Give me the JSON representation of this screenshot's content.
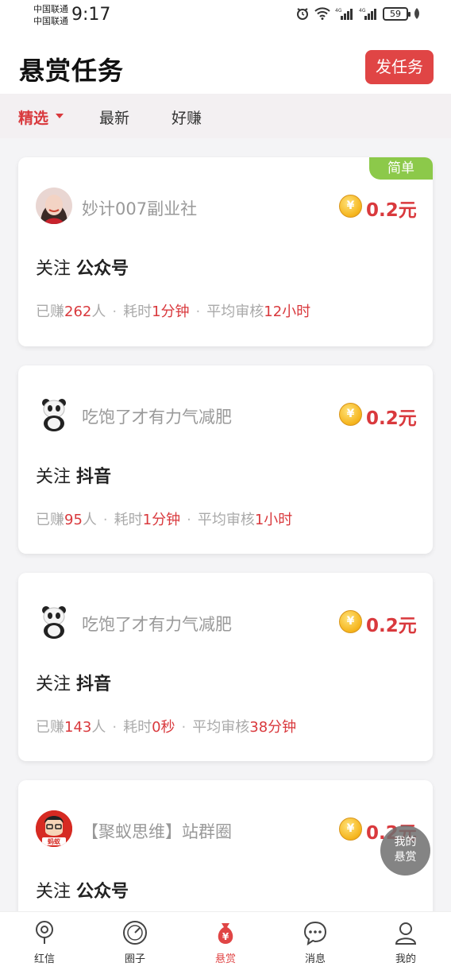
{
  "statusbar": {
    "carrier1": "中国联通",
    "carrier2": "中国联通",
    "time": "9:17",
    "battery": "59",
    "network1": "4G",
    "network2": "4G"
  },
  "header": {
    "title": "悬赏任务",
    "post_button": "发任务"
  },
  "tabs": [
    {
      "label": "精选"
    },
    {
      "label": "最新"
    },
    {
      "label": "好赚"
    }
  ],
  "tasks": [
    {
      "badge": "简单",
      "poster": "妙计007副业社",
      "reward": "0.2元",
      "action": "关注",
      "platform": "公众号",
      "earned_label": "已赚",
      "earned": "262",
      "earned_unit": "人",
      "time_label": "耗时",
      "time": "1分钟",
      "review_label": "平均审核",
      "review": "12小时"
    },
    {
      "poster": "吃饱了才有力气减肥",
      "reward": "0.2元",
      "action": "关注",
      "platform": "抖音",
      "earned_label": "已赚",
      "earned": "95",
      "earned_unit": "人",
      "time_label": "耗时",
      "time": "1分钟",
      "review_label": "平均审核",
      "review": "1小时"
    },
    {
      "poster": "吃饱了才有力气减肥",
      "reward": "0.2元",
      "action": "关注",
      "platform": "抖音",
      "earned_label": "已赚",
      "earned": "143",
      "earned_unit": "人",
      "time_label": "耗时",
      "time": "0秒",
      "review_label": "平均审核",
      "review": "38分钟"
    },
    {
      "poster": "【聚蚁思维】站群圈",
      "reward": "0.2元",
      "action": "关注",
      "platform": "公众号",
      "avatar_text": "蚂蚁"
    }
  ],
  "fab": {
    "line1": "我的",
    "line2": "悬赏"
  },
  "bottom_nav": [
    {
      "label": "红信",
      "icon": "location-pin-icon"
    },
    {
      "label": "圈子",
      "icon": "compass-icon"
    },
    {
      "label": "悬赏",
      "icon": "money-bag-icon",
      "active": true
    },
    {
      "label": "消息",
      "icon": "chat-bubble-icon"
    },
    {
      "label": "我的",
      "icon": "person-icon"
    }
  ],
  "colors": {
    "accent": "#e04545",
    "badge_green": "#8cc94a",
    "coin": "#f5b41b"
  }
}
